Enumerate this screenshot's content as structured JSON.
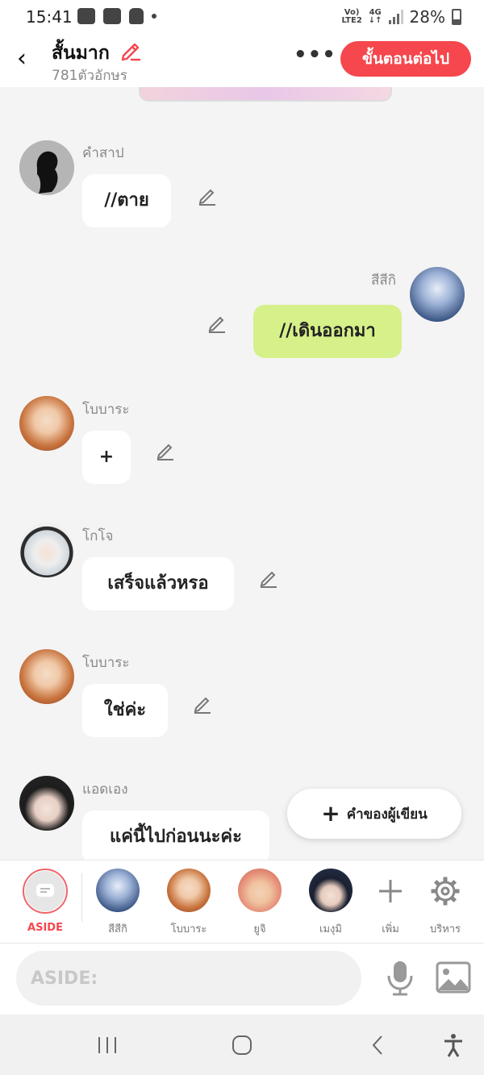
{
  "status_bar": {
    "time": "15:41",
    "network_top": "Vo)",
    "network_bottom": "LTE2",
    "data_top": "4G",
    "data_bottom": "↓↑",
    "battery": "28%"
  },
  "header": {
    "title": "สั้นมาก",
    "char_count": "781ตัวอักษร",
    "more": "•••",
    "next_label": "ขั้นตอนต่อไป"
  },
  "messages": [
    {
      "name": "คำสาป",
      "text": "//ตาย",
      "side": "left"
    },
    {
      "name": "สีสีกิ",
      "text": "//เดินออกมา",
      "side": "right"
    },
    {
      "name": "โบบาระ",
      "text": "+",
      "side": "left"
    },
    {
      "name": "โกโจ",
      "text": "เสร็จแล้วหรอ",
      "side": "left"
    },
    {
      "name": "โบบาระ",
      "text": "ใช่ค่ะ",
      "side": "left"
    },
    {
      "name": "แอดเอง",
      "text": "แค่นี้ไปก่อนนะค่ะ",
      "side": "left"
    }
  ],
  "author_aside_button": {
    "plus": "+",
    "label": "คำของผู้เขียน"
  },
  "character_bar": {
    "aside_label": "ASIDE",
    "characters": [
      "สีสีกิ",
      "โบบาระ",
      "ยูจิ",
      "เมงุมิ"
    ],
    "add_label": "เพิ่ม",
    "manage_label": "บริหาร"
  },
  "input": {
    "placeholder": "ASIDE:"
  },
  "colors": {
    "accent": "#f5474d",
    "bubble_self": "#d6f08a",
    "bubble_other": "#ffffff",
    "background": "#f4f4f4"
  }
}
